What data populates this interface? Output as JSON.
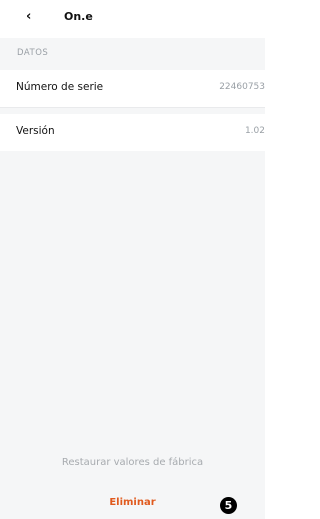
{
  "header": {
    "back_icon": "‹",
    "title": "On.e"
  },
  "section": {
    "label": "DATOS"
  },
  "rows": [
    {
      "label": "Número de serie",
      "value": "22460753"
    },
    {
      "label": "Versión",
      "value": "1.02"
    }
  ],
  "actions": {
    "restore_label": "Restaurar valores de fábrica",
    "delete_label": "Eliminar"
  },
  "badge": {
    "number": "5"
  },
  "colors": {
    "background": "#f5f6f7",
    "delete": "#e05a1e",
    "muted": "#a7abaf"
  }
}
